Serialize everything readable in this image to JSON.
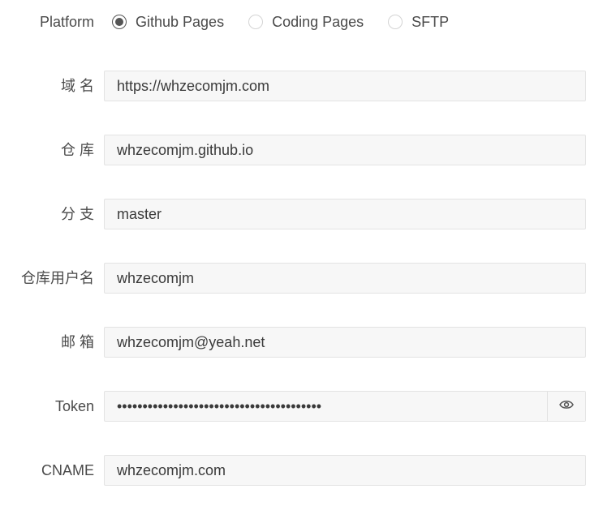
{
  "platform": {
    "label": "Platform",
    "options": [
      {
        "label": "Github Pages",
        "checked": true
      },
      {
        "label": "Coding Pages",
        "checked": false
      },
      {
        "label": "SFTP",
        "checked": false
      }
    ]
  },
  "fields": {
    "domain": {
      "label": "域 名",
      "value": "https://whzecomjm.com"
    },
    "repository": {
      "label": "仓 库",
      "value": "whzecomjm.github.io"
    },
    "branch": {
      "label": "分 支",
      "value": "master"
    },
    "username": {
      "label": "仓库用户名",
      "value": "whzecomjm"
    },
    "email": {
      "label": "邮 箱",
      "value": "whzecomjm@yeah.net"
    },
    "token": {
      "label": "Token",
      "value": "••••••••••••••••••••••••••••••••••••••••"
    },
    "cname": {
      "label": "CNAME",
      "value": "whzecomjm.com"
    }
  },
  "icons": {
    "token_toggle": "eye-icon"
  }
}
